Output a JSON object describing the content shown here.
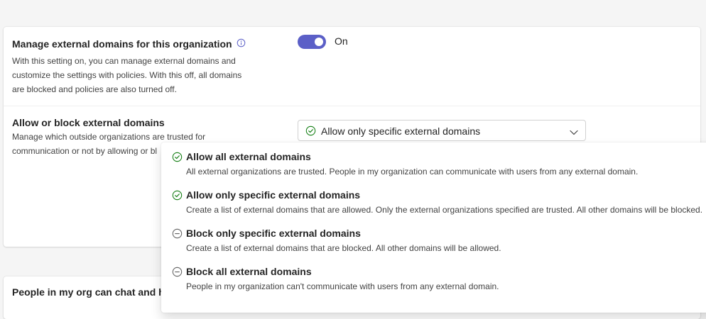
{
  "setting1": {
    "title": "Manage external domains for this organization",
    "desc_lines": [
      "With this setting on, you can manage external domains and",
      "customize the settings with policies. With this off, all domains",
      "are blocked and policies are also turned off."
    ],
    "toggle_label": "On",
    "toggle_on": true
  },
  "setting2": {
    "title": "Allow or block external domains",
    "desc_lines": [
      "Manage which outside organizations are trusted for",
      "communication or not by allowing or bl"
    ],
    "selected_value": "Allow only specific external domains"
  },
  "dropdown": {
    "options": [
      {
        "label": "Allow all external domains",
        "desc": "All external organizations are trusted. People in my organization can communicate with users from any external domain.",
        "icon": "check-circle-icon"
      },
      {
        "label": "Allow only specific external domains",
        "desc": "Create a list of external domains that are allowed. Only the external organizations specified are trusted. All other domains will be blocked.",
        "icon": "check-circle-icon"
      },
      {
        "label": "Block only specific external domains",
        "desc": "Create a list of external domains that are blocked. All other domains will be allowed.",
        "icon": "minus-circle-icon"
      },
      {
        "label": "Block all external domains",
        "desc": "People in my organization can't communicate with users from any external domain.",
        "icon": "minus-circle-icon"
      }
    ]
  },
  "setting3": {
    "title": "People in my org can chat and ha"
  },
  "colors": {
    "accent": "#5b5fc7",
    "check": "#107c10",
    "minus": "#616161"
  }
}
